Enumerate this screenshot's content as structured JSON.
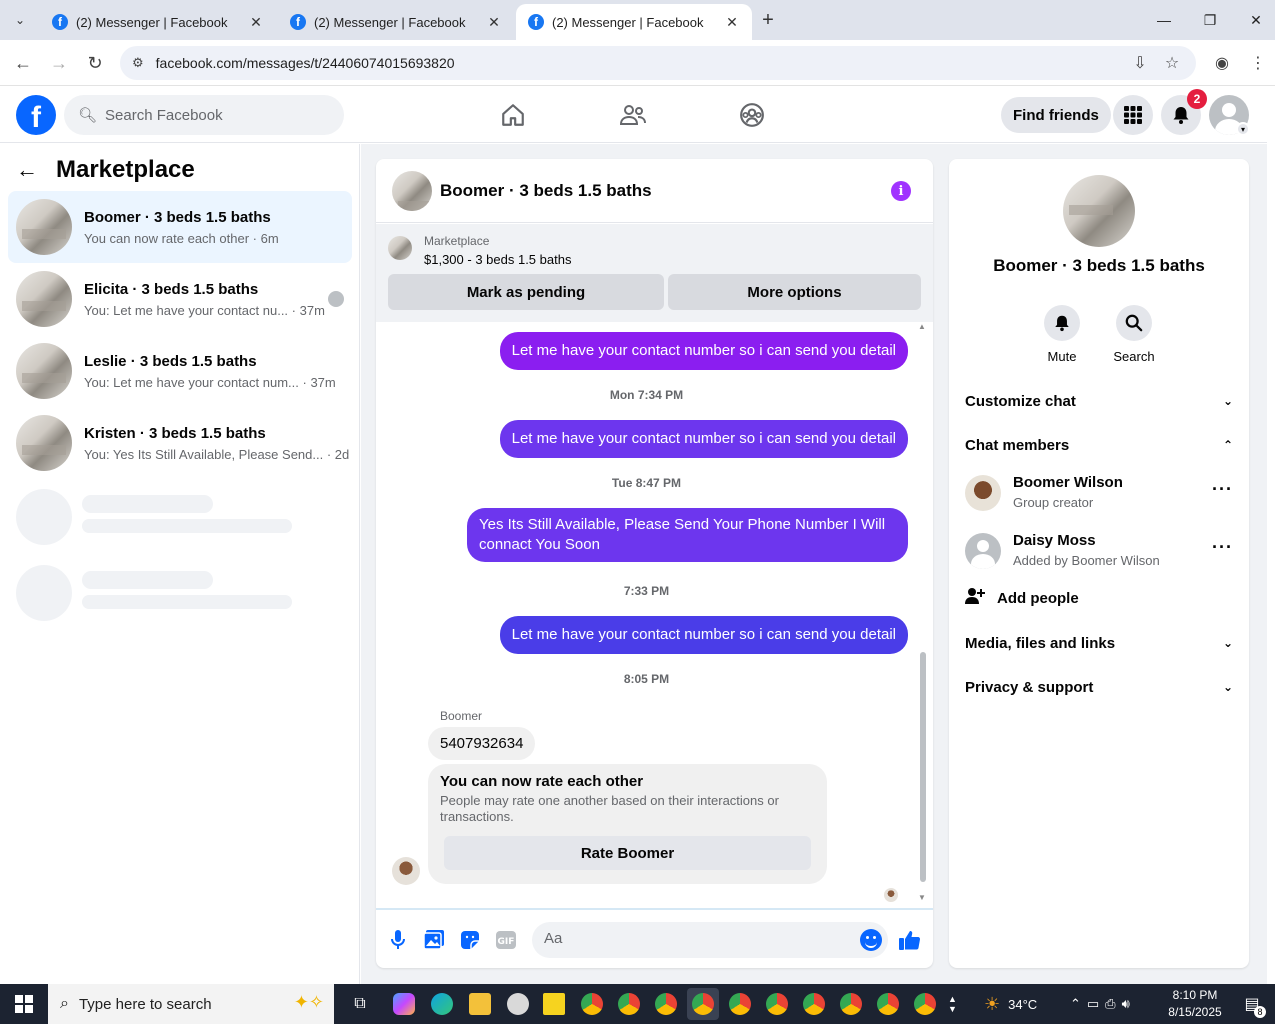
{
  "browser": {
    "tabs": [
      {
        "title": "(2) Messenger | Facebook"
      },
      {
        "title": "(2) Messenger | Facebook"
      },
      {
        "title": "(2) Messenger | Facebook"
      }
    ],
    "url": "facebook.com/messages/t/24406074015693820"
  },
  "fb": {
    "search_placeholder": "Search Facebook",
    "find_friends": "Find friends",
    "notif_count": "2"
  },
  "sidebar": {
    "title": "Marketplace",
    "conversations": [
      {
        "name": "Boomer · 3 beds 1.5 baths",
        "preview": "You can now rate each other",
        "time": "6m"
      },
      {
        "name": "Elicita · 3 beds 1.5 baths",
        "preview": "You: Let me have your contact nu...",
        "time": "37m"
      },
      {
        "name": "Leslie · 3 beds 1.5 baths",
        "preview": "You: Let me have your contact num...",
        "time": "37m"
      },
      {
        "name": "Kristen · 3 beds 1.5 baths",
        "preview": "You: Yes Its Still Available, Please Send...",
        "time": "2d"
      }
    ]
  },
  "chat": {
    "title": "Boomer · 3 beds 1.5 baths",
    "marketplace_label": "Marketplace",
    "listing": "$1,300 - 3 beds 1.5 baths",
    "mark_pending": "Mark as pending",
    "more_options": "More options",
    "messages": {
      "m1": "Let me have your contact number so i can send you detail",
      "ts1": "Mon 7:34 PM",
      "m2": "Let me have your contact number so i can send you detail",
      "ts2": "Tue 8:47 PM",
      "m3": "Yes Its Still Available, Please Send Your Phone Number I Will connact You Soon",
      "ts3": "7:33 PM",
      "m4": "Let me have your contact number so i can send you detail",
      "ts4": "8:05 PM",
      "sender": "Boomer",
      "in1": "5407932634"
    },
    "rate": {
      "title": "You can now rate each other",
      "desc": "People may rate one another based on their interactions or transactions.",
      "button": "Rate Boomer"
    },
    "composer_placeholder": "Aa"
  },
  "right_panel": {
    "name": "Boomer · 3 beds 1.5 baths",
    "mute": "Mute",
    "search": "Search",
    "customize": "Customize chat",
    "members_title": "Chat members",
    "members": [
      {
        "name": "Boomer Wilson",
        "role": "Group creator"
      },
      {
        "name": "Daisy Moss",
        "role": "Added by Boomer Wilson"
      }
    ],
    "add_people": "Add people",
    "media": "Media, files and links",
    "privacy": "Privacy & support"
  },
  "taskbar": {
    "search_placeholder": "Type here to search",
    "temp": "34°C",
    "time": "8:10 PM",
    "date": "8/15/2025",
    "notif_count": "8"
  }
}
